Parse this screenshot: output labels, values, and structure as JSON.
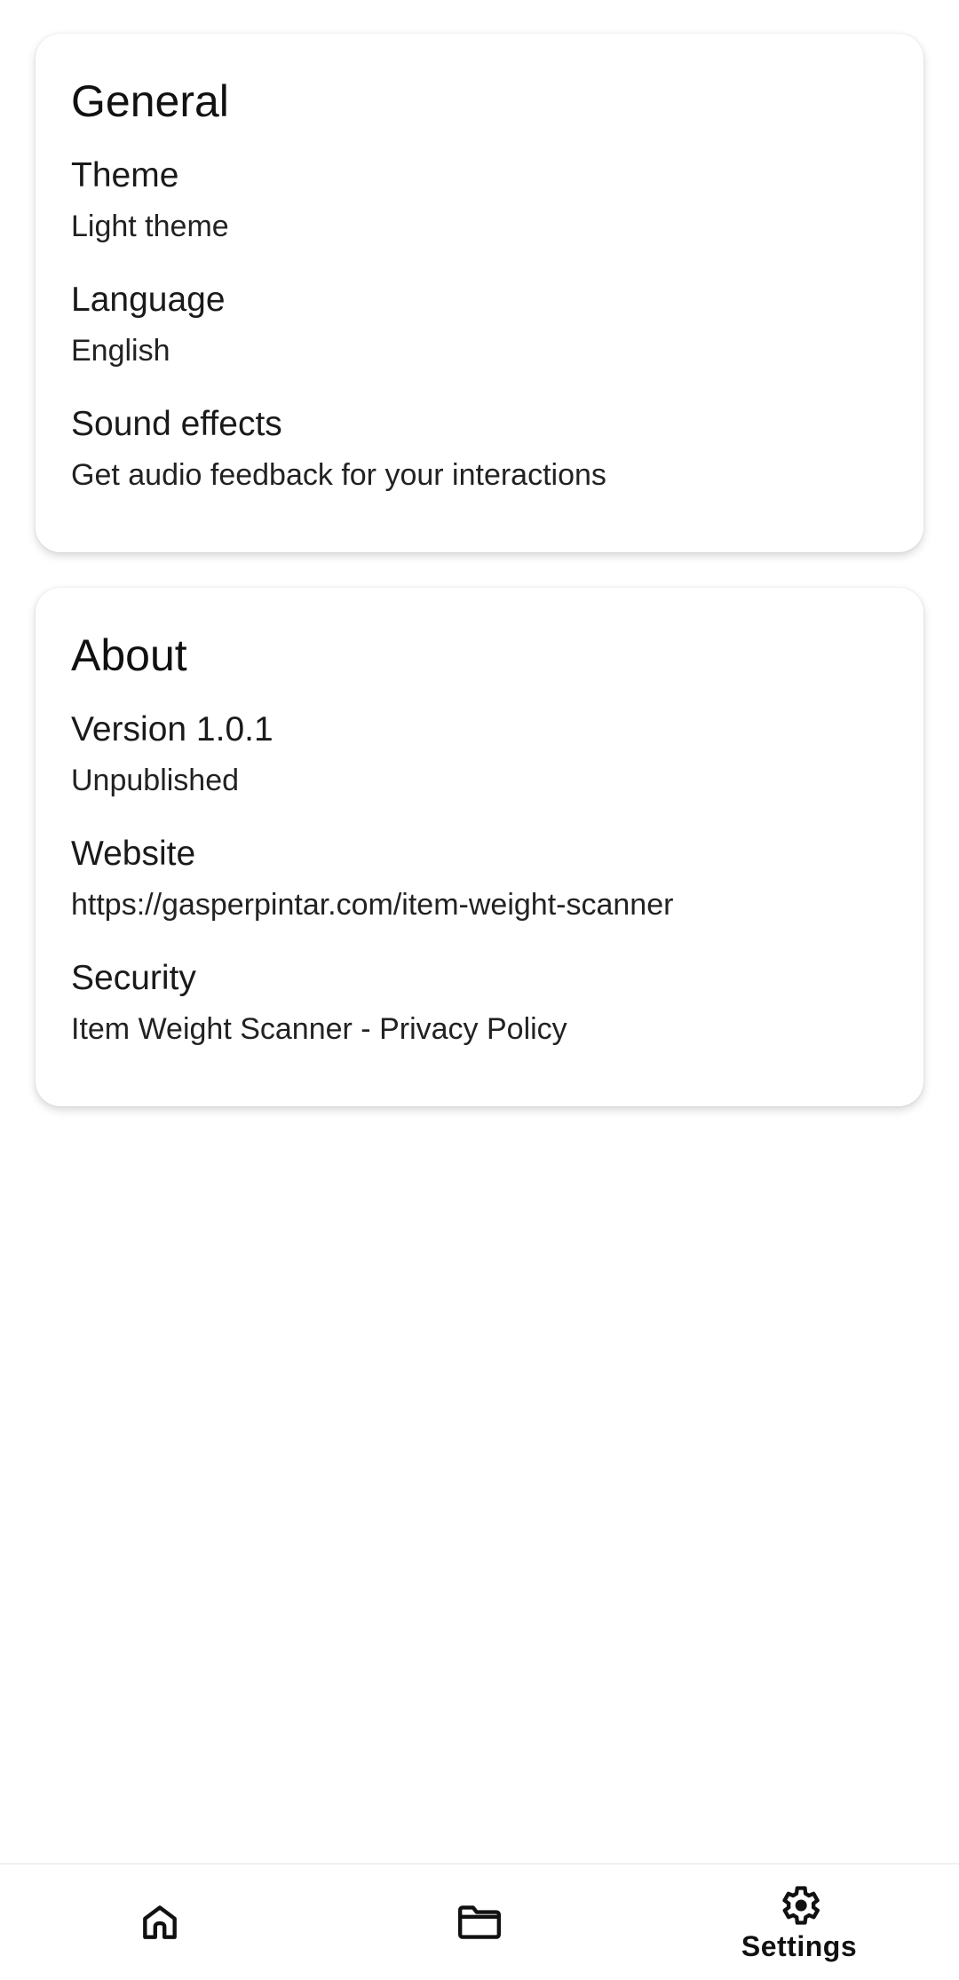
{
  "general": {
    "title": "General",
    "items": [
      {
        "title": "Theme",
        "subtitle": "Light theme"
      },
      {
        "title": "Language",
        "subtitle": "English"
      },
      {
        "title": "Sound effects",
        "subtitle": "Get audio feedback for your interactions"
      }
    ]
  },
  "about": {
    "title": "About",
    "items": [
      {
        "title": "Version 1.0.1",
        "subtitle": "Unpublished"
      },
      {
        "title": "Website",
        "subtitle": "https://gasperpintar.com/item-weight-scanner"
      },
      {
        "title": "Security",
        "subtitle": "Item Weight Scanner - Privacy Policy"
      }
    ]
  },
  "bottom_nav": {
    "items": [
      {
        "icon": "home-icon",
        "label": ""
      },
      {
        "icon": "folder-icon",
        "label": ""
      },
      {
        "icon": "gear-icon",
        "label": "Settings",
        "selected": true
      }
    ]
  }
}
